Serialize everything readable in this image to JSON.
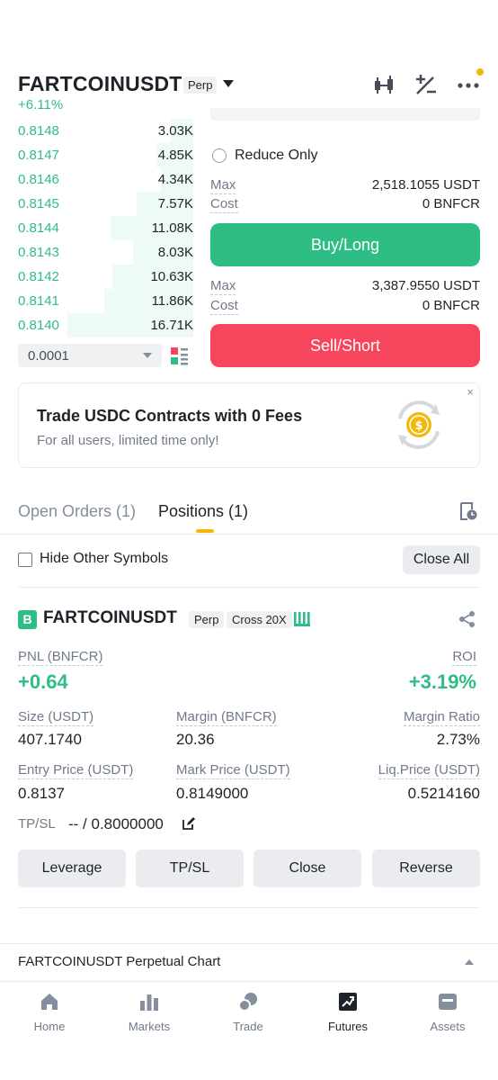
{
  "header": {
    "symbol": "FARTCOINUSDT",
    "contract_type": "Perp",
    "change": "+6.11%"
  },
  "orderbook": {
    "rows": [
      {
        "price": "0.8148",
        "qty": "3.03K",
        "depth": 0.18
      },
      {
        "price": "0.8147",
        "qty": "4.85K",
        "depth": 0.29
      },
      {
        "price": "0.8146",
        "qty": "4.34K",
        "depth": 0.26
      },
      {
        "price": "0.8145",
        "qty": "7.57K",
        "depth": 0.45
      },
      {
        "price": "0.8144",
        "qty": "11.08K",
        "depth": 0.66
      },
      {
        "price": "0.8143",
        "qty": "8.03K",
        "depth": 0.48
      },
      {
        "price": "0.8142",
        "qty": "10.63K",
        "depth": 0.64
      },
      {
        "price": "0.8141",
        "qty": "11.86K",
        "depth": 0.71
      },
      {
        "price": "0.8140",
        "qty": "16.71K",
        "depth": 1.0
      }
    ],
    "tick_size": "0.0001"
  },
  "order_panel": {
    "reduce_only": "Reduce Only",
    "buy": {
      "max_label": "Max",
      "max_value": "2,518.1055 USDT",
      "cost_label": "Cost",
      "cost_value": "0 BNFCR",
      "button": "Buy/Long"
    },
    "sell": {
      "max_label": "Max",
      "max_value": "3,387.9550 USDT",
      "cost_label": "Cost",
      "cost_value": "0 BNFCR",
      "button": "Sell/Short"
    }
  },
  "promo": {
    "title": "Trade USDC Contracts with 0 Fees",
    "subtitle": "For all users, limited time only!",
    "close": "×"
  },
  "tabs": {
    "open_orders": "Open Orders (1)",
    "positions": "Positions (1)"
  },
  "filters": {
    "hide_other": "Hide Other Symbols",
    "close_all": "Close All"
  },
  "position": {
    "side_badge": "B",
    "symbol": "FARTCOINUSDT",
    "type": "Perp",
    "margin_mode": "Cross 20X",
    "pnl_label": "PNL (BNFCR)",
    "pnl_value": "+0.64",
    "roi_label": "ROI",
    "roi_value": "+3.19%",
    "size_label": "Size (USDT)",
    "size_value": "407.1740",
    "margin_label": "Margin (BNFCR)",
    "margin_value": "20.36",
    "margin_ratio_label": "Margin Ratio",
    "margin_ratio_value": "2.73%",
    "entry_label": "Entry Price (USDT)",
    "entry_value": "0.8137",
    "mark_label": "Mark Price (USDT)",
    "mark_value": "0.8149000",
    "liq_label": "Liq.Price (USDT)",
    "liq_value": "0.5214160",
    "tpsl_label": "TP/SL",
    "tpsl_value": "-- / 0.8000000",
    "actions": {
      "leverage": "Leverage",
      "tpsl": "TP/SL",
      "close": "Close",
      "reverse": "Reverse"
    }
  },
  "chart_section": {
    "label": "FARTCOINUSDT Perpetual  Chart"
  },
  "nav": {
    "home": "Home",
    "markets": "Markets",
    "trade": "Trade",
    "futures": "Futures",
    "assets": "Assets"
  },
  "colors": {
    "buy": "#2ebd85",
    "sell": "#f6465d",
    "accent": "#f0b90b"
  }
}
